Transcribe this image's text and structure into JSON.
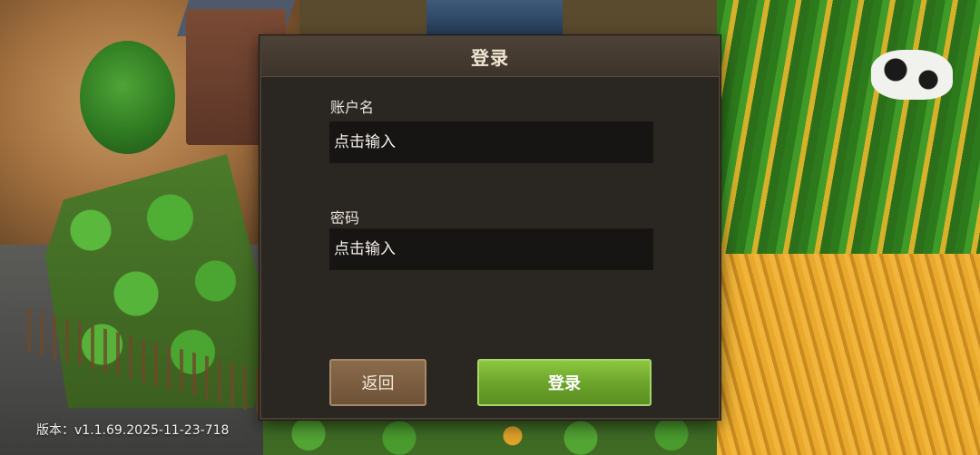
{
  "dialog": {
    "title": "登录",
    "username": {
      "label": "账户名",
      "placeholder": "点击输入",
      "value": ""
    },
    "password": {
      "label": "密码",
      "placeholder": "点击输入",
      "value": ""
    },
    "buttons": {
      "back_label": "返回",
      "login_label": "登录"
    }
  },
  "footer": {
    "version": "版本：v1.1.69.2025-11-23-718"
  },
  "colors": {
    "dialog_bg": "#2a2622",
    "header_bg": "#4d4236",
    "input_bg": "#171514",
    "back_button": "#7a5d40",
    "login_button": "#7ab535"
  }
}
